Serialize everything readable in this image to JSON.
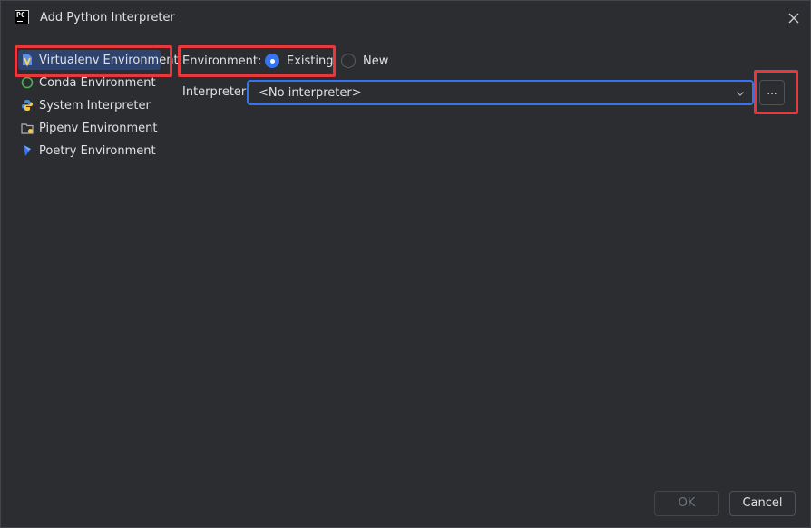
{
  "window": {
    "app_icon_text": "PC",
    "title": "Add Python Interpreter",
    "close_icon": "close-icon"
  },
  "sidebar": {
    "items": [
      {
        "label": "Virtualenv Environment",
        "icon": "virtualenv-icon",
        "selected": true
      },
      {
        "label": "Conda Environment",
        "icon": "conda-icon",
        "selected": false
      },
      {
        "label": "System Interpreter",
        "icon": "python-icon",
        "selected": false
      },
      {
        "label": "Pipenv Environment",
        "icon": "pipenv-icon",
        "selected": false
      },
      {
        "label": "Poetry Environment",
        "icon": "poetry-icon",
        "selected": false
      }
    ]
  },
  "form": {
    "environment_label": "Environment:",
    "options": [
      {
        "label": "Existing",
        "checked": true
      },
      {
        "label": "New",
        "checked": false
      }
    ],
    "interpreter_label": "Interpreter:",
    "interpreter_value": "<No interpreter>",
    "browse_label": "..."
  },
  "footer": {
    "ok_label": "OK",
    "ok_enabled": false,
    "cancel_label": "Cancel"
  },
  "colors": {
    "accent": "#3574f0",
    "highlight": "#e8383b",
    "background": "#2b2d30",
    "selection": "#2e436e"
  }
}
